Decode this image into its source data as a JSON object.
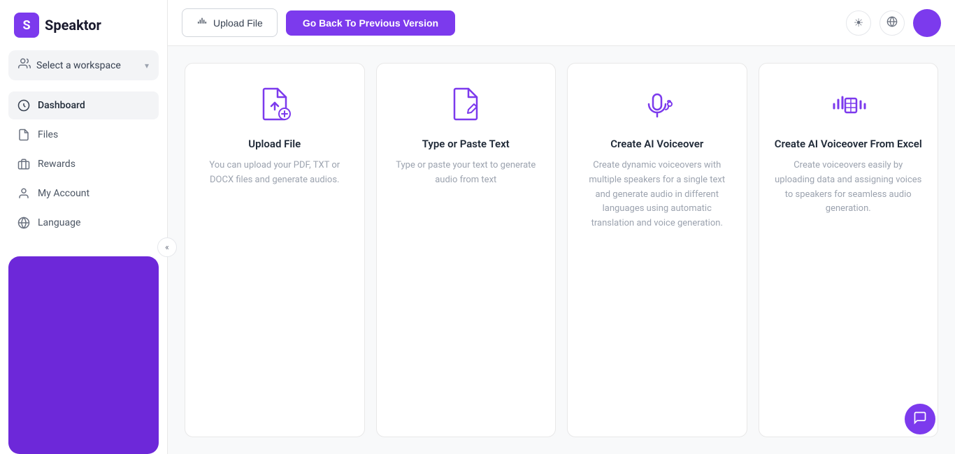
{
  "app": {
    "name": "Speaktor",
    "logo_letter": "S"
  },
  "sidebar": {
    "workspace": {
      "label": "Select a workspace",
      "chevron": "▾"
    },
    "nav_items": [
      {
        "id": "dashboard",
        "label": "Dashboard",
        "icon": "dashboard"
      },
      {
        "id": "files",
        "label": "Files",
        "icon": "files"
      },
      {
        "id": "rewards",
        "label": "Rewards",
        "icon": "rewards"
      },
      {
        "id": "my-account",
        "label": "My Account",
        "icon": "account"
      },
      {
        "id": "language",
        "label": "Language",
        "icon": "language"
      }
    ],
    "collapse_label": "«"
  },
  "topbar": {
    "upload_button": "Upload File",
    "back_button": "Go Back To Previous Version"
  },
  "cards": [
    {
      "id": "upload-file",
      "title": "Upload File",
      "description": "You can upload your PDF, TXT or DOCX files and generate audios.",
      "icon": "upload-file-icon"
    },
    {
      "id": "type-paste-text",
      "title": "Type or Paste Text",
      "description": "Type or paste your text to generate audio from text",
      "icon": "edit-text-icon"
    },
    {
      "id": "create-ai-voiceover",
      "title": "Create AI Voiceover",
      "description": "Create dynamic voiceovers with multiple speakers for a single text and generate audio in different languages using automatic translation and voice generation.",
      "icon": "voiceover-icon"
    },
    {
      "id": "create-ai-voiceover-excel",
      "title": "Create AI Voiceover From Excel",
      "description": "Create voiceovers easily by uploading data and assigning voices to speakers for seamless audio generation.",
      "icon": "excel-voiceover-icon"
    }
  ],
  "colors": {
    "brand_purple": "#7c3aed",
    "light_purple": "#6d28d9"
  }
}
